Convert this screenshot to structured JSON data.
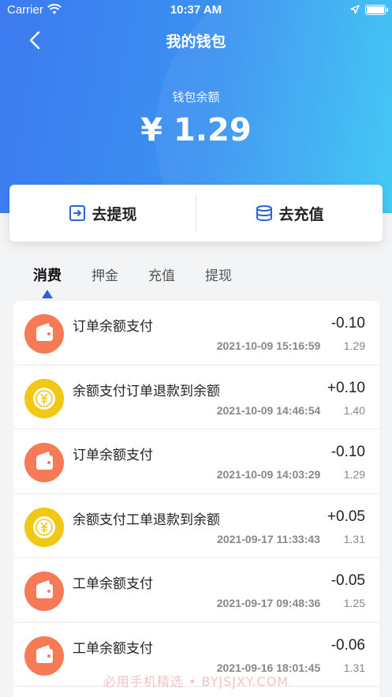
{
  "status_bar": {
    "carrier": "Carrier",
    "time": "10:37 AM"
  },
  "header": {
    "title": "我的钱包"
  },
  "balance": {
    "label": "钱包余额",
    "amount": "¥ 1.29"
  },
  "actions": {
    "withdraw_label": "去提现",
    "recharge_label": "去充值"
  },
  "tabs": [
    {
      "label": "消费"
    },
    {
      "label": "押金"
    },
    {
      "label": "充值"
    },
    {
      "label": "提现"
    }
  ],
  "transactions": [
    {
      "title": "订单余额支付",
      "time": "2021-10-09 15:16:59",
      "amount": "-0.10",
      "balance": "1.29",
      "icon": "wallet-icon"
    },
    {
      "title": "余额支付订单退款到余额",
      "time": "2021-10-09 14:46:54",
      "amount": "+0.10",
      "balance": "1.40",
      "icon": "coin-icon"
    },
    {
      "title": "订单余额支付",
      "time": "2021-10-09 14:03:29",
      "amount": "-0.10",
      "balance": "1.29",
      "icon": "wallet-icon"
    },
    {
      "title": "余额支付工单退款到余额",
      "time": "2021-09-17 11:33:43",
      "amount": "+0.05",
      "balance": "1.31",
      "icon": "coin-icon"
    },
    {
      "title": "工单余额支付",
      "time": "2021-09-17 09:48:36",
      "amount": "-0.05",
      "balance": "1.25",
      "icon": "wallet-icon"
    },
    {
      "title": "工单余额支付",
      "time": "2021-09-16 18:01:45",
      "amount": "-0.06",
      "balance": "1.31",
      "icon": "wallet-icon"
    }
  ],
  "watermark": "必用手机精选 • BYJSJXY.COM",
  "colors": {
    "accent": "#2a63d8",
    "gradient_start": "#3d7af0",
    "gradient_end": "#39c6f4",
    "wallet_icon_bg": "#f57a55",
    "coin_icon_bg": "#f2c815"
  }
}
